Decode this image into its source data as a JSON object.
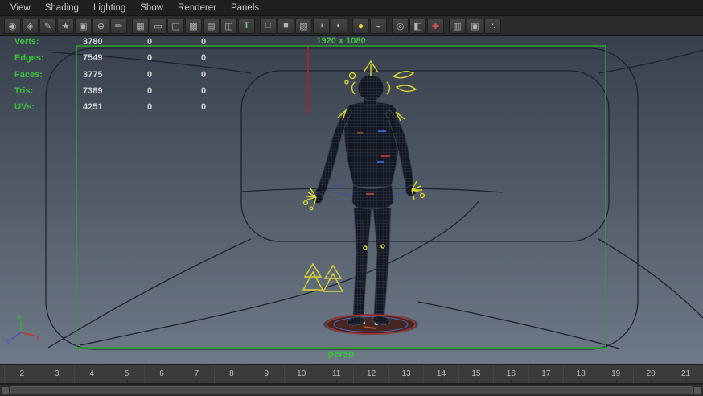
{
  "menu": {
    "items": [
      "View",
      "Shading",
      "Lighting",
      "Show",
      "Renderer",
      "Panels"
    ]
  },
  "toolbar": {
    "icons": [
      {
        "name": "select-camera-icon",
        "glyph": "◉"
      },
      {
        "name": "lock-camera-icon",
        "glyph": "◈"
      },
      {
        "name": "camera-attributes-icon",
        "glyph": "✎"
      },
      {
        "name": "bookmark-icon",
        "glyph": "★"
      },
      {
        "name": "image-plane-icon",
        "glyph": "▣"
      },
      {
        "name": "pan-zoom-icon",
        "glyph": "⊕"
      },
      {
        "name": "grease-pencil-icon",
        "glyph": "✏"
      },
      {
        "name": "grid-icon",
        "glyph": "▦"
      },
      {
        "name": "film-gate-icon",
        "glyph": "▭"
      },
      {
        "name": "resolution-gate-icon",
        "glyph": "▢"
      },
      {
        "name": "gate-mask-icon",
        "glyph": "▩"
      },
      {
        "name": "field-chart-icon",
        "glyph": "▤"
      },
      {
        "name": "safe-action-icon",
        "glyph": "◫"
      },
      {
        "name": "safe-title-icon",
        "glyph": "T"
      },
      {
        "name": "wireframe-icon",
        "glyph": "□"
      },
      {
        "name": "smooth-shade-icon",
        "glyph": "■"
      },
      {
        "name": "textured-icon",
        "glyph": "▨"
      },
      {
        "name": "lighting-icon",
        "glyph": "◑"
      },
      {
        "name": "shadows-icon",
        "glyph": "◐"
      },
      {
        "name": "exposure-icon",
        "glyph": "●"
      },
      {
        "name": "gamma-icon",
        "glyph": "◒"
      },
      {
        "name": "isolate-select-icon",
        "glyph": "◎"
      },
      {
        "name": "xray-icon",
        "glyph": "◧"
      },
      {
        "name": "joint-xray-icon",
        "glyph": "✚"
      },
      {
        "name": "plugin-icon",
        "glyph": "▥"
      },
      {
        "name": "scene-assembly-icon",
        "glyph": "▣"
      },
      {
        "name": "share-network-icon",
        "glyph": "∴"
      }
    ]
  },
  "hud": {
    "rows": [
      {
        "label": "Verts:",
        "total": "3780",
        "col2": "0",
        "col3": "0"
      },
      {
        "label": "Edges:",
        "total": "7549",
        "col2": "0",
        "col3": "0"
      },
      {
        "label": "Faces:",
        "total": "3775",
        "col2": "0",
        "col3": "0"
      },
      {
        "label": "Tris:",
        "total": "7389",
        "col2": "0",
        "col3": "0"
      },
      {
        "label": "UVs:",
        "total": "4251",
        "col2": "0",
        "col3": "0"
      }
    ],
    "resolution": "1920 x 1080"
  },
  "viewport": {
    "camera": "persp"
  },
  "axis_gizmo": {
    "x": "x",
    "y": "y",
    "z": "z"
  },
  "timeline": {
    "frames": [
      "2",
      "3",
      "4",
      "5",
      "6",
      "7",
      "8",
      "9",
      "10",
      "11",
      "12",
      "13",
      "14",
      "15",
      "16",
      "17",
      "18",
      "19",
      "20",
      "21"
    ]
  },
  "colors": {
    "hud_text_green": "#3fbf3f",
    "gate_border_green": "#2f9e2f",
    "rig_control_yellow": "#ddd431",
    "axis_x_red": "#c23434",
    "axis_y_green": "#35b135",
    "axis_z_blue": "#4a62dd",
    "viewport_gradient_top": "#37404c",
    "viewport_gradient_bottom": "#6e7987"
  }
}
